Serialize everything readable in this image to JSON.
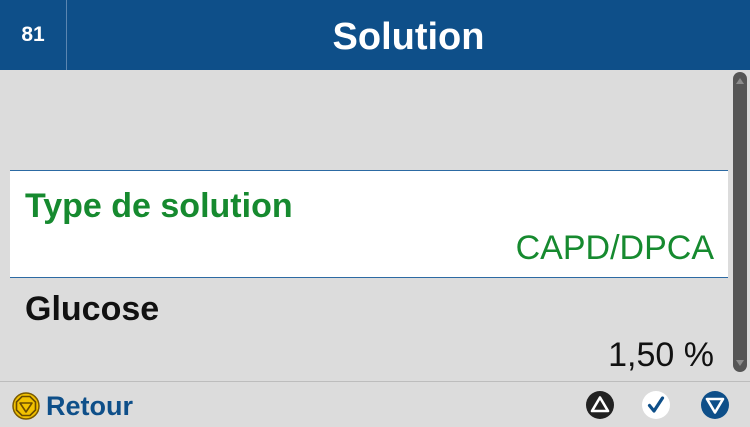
{
  "header": {
    "screen_number": "81",
    "title": "Solution"
  },
  "list": {
    "items": [
      {
        "label": "Type de solution",
        "value": "CAPD/DPCA",
        "selected": true
      },
      {
        "label": "Glucose",
        "value": "1,50 %",
        "selected": false
      }
    ]
  },
  "footer": {
    "back_label": "Retour",
    "back_icon": "stop-back-icon",
    "up_icon": "up-triangle-icon",
    "confirm_icon": "check-icon",
    "down_icon": "down-triangle-icon"
  },
  "colors": {
    "header_bg": "#0e4f89",
    "selected_text": "#168a2f",
    "back_icon_yellow": "#f2c200",
    "nav_blue": "#0e4f89",
    "nav_dark": "#222222"
  }
}
